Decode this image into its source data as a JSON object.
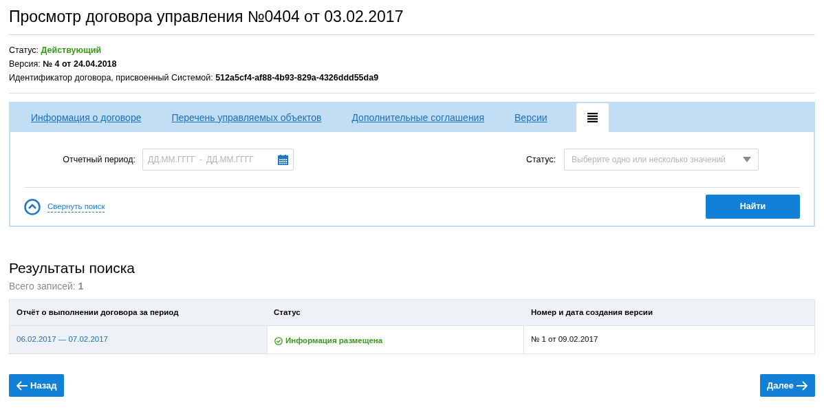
{
  "title": "Просмотр договора управления №0404 от 03.02.2017",
  "details": [
    {
      "label": "Статус:",
      "value": "Действующий",
      "color": "#3a9a1a"
    },
    {
      "label": "Версия:",
      "value": "№ 4 от 24.04.2018",
      "color": "#000000"
    },
    {
      "label": "Идентификатор договора, присвоенный Системой:",
      "value": "512a5cf4-af88-4b93-829a-4326ddd55da9",
      "color": "#000000"
    }
  ],
  "tabs": [
    {
      "kind": "link",
      "label": "Информация о договоре",
      "selected": false
    },
    {
      "kind": "link",
      "label": "Перечень управляемых объектов",
      "selected": false
    },
    {
      "kind": "link",
      "label": "Дополнительные соглашения",
      "selected": false
    },
    {
      "kind": "link",
      "label": "Версии",
      "selected": false
    },
    {
      "kind": "icon",
      "selected": true
    }
  ],
  "filters": {
    "period": {
      "label": "Отчетный период:",
      "from_placeholder": "ДД.ММ.ГГГГ",
      "separator": "-",
      "to_placeholder": "ДД.ММ.ГГГГ"
    },
    "status": {
      "label": "Статус:",
      "placeholder": "Выберите одно или несколько значений"
    },
    "collapse_link": "Свернуть поиск",
    "find_button": "Найти"
  },
  "results": {
    "title": "Результаты поиска",
    "count_label": "Всего записей:",
    "count": "1",
    "table": {
      "columns": [
        "Отчёт о выполнении договора за период",
        "Статус",
        "Номер и дата создания версии"
      ],
      "rows": [
        {
          "period": "06.02.2017 — 07.02.2017",
          "status": {
            "kind": "ok",
            "text": "Информация размещена"
          },
          "version": "№ 1 от 09.02.2017"
        }
      ]
    }
  },
  "nav": {
    "back": "Назад",
    "next": "Далее"
  }
}
